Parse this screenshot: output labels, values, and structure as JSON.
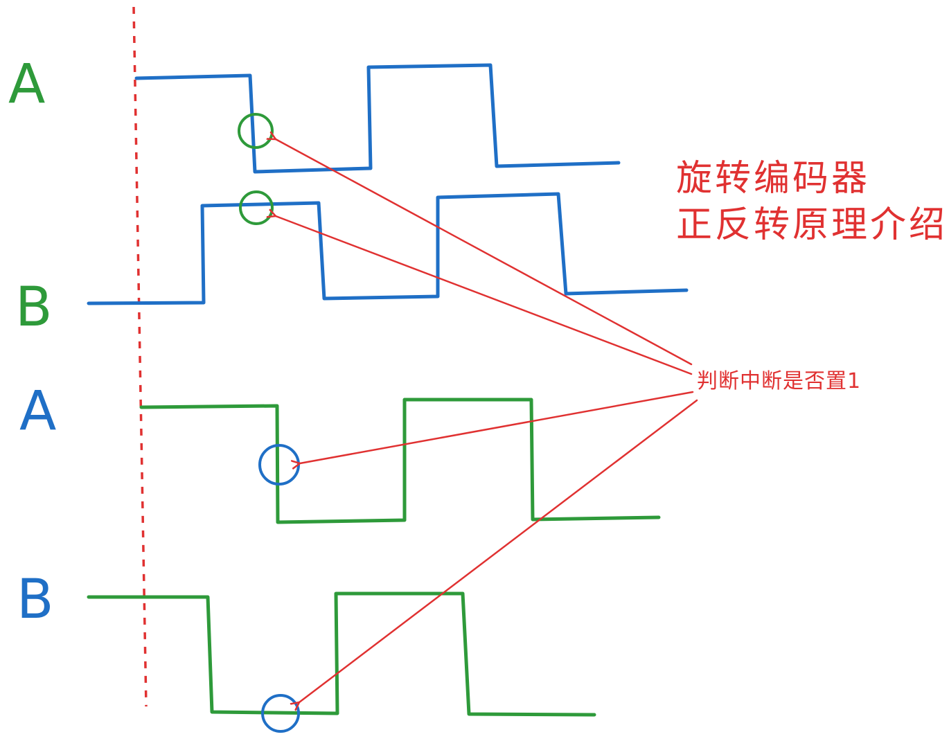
{
  "title": {
    "line1": "旋转编码器",
    "line2": "正反转原理介绍"
  },
  "note": "判断中断是否置1",
  "labels": {
    "a_top": "A",
    "b_top": "B",
    "a_bottom": "A",
    "b_bottom": "B"
  },
  "colors": {
    "blue": "#1f6fc6",
    "green": "#2e9a3a",
    "red": "#e03131"
  }
}
